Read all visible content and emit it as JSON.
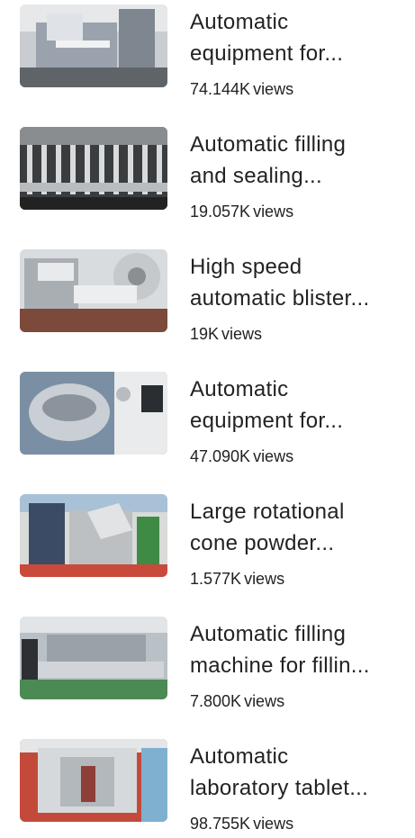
{
  "videos": [
    {
      "title_line1": "Automatic",
      "title_line2": "equipment for...",
      "views": "74.144K",
      "thumb_icon": "machine-photo",
      "accent": "#9aa3ad"
    },
    {
      "title_line1": "Automatic filling",
      "title_line2": "and sealing...",
      "views": "19.057K",
      "thumb_icon": "filling-line-photo",
      "accent": "#6b6f73"
    },
    {
      "title_line1": "High speed",
      "title_line2": "automatic blister...",
      "views": "19K",
      "thumb_icon": "blister-machine-photo",
      "accent": "#b8bcc0"
    },
    {
      "title_line1": "Automatic",
      "title_line2": "equipment for...",
      "views": "47.090K",
      "thumb_icon": "mixer-photo",
      "accent": "#8fa3b4"
    },
    {
      "title_line1": "Large rotational",
      "title_line2": "cone powder...",
      "views": "1.577K",
      "thumb_icon": "cone-mixer-photo",
      "accent": "#c7c9c5"
    },
    {
      "title_line1": "Automatic filling",
      "title_line2": "machine for fillin...",
      "views": "7.800K",
      "thumb_icon": "exhibition-line-photo",
      "accent": "#8a9a8a"
    },
    {
      "title_line1": "Automatic",
      "title_line2": "laboratory tablet...",
      "views": "98.755K",
      "thumb_icon": "tablet-press-photo",
      "accent": "#c34a3a"
    }
  ],
  "views_suffix": "views"
}
